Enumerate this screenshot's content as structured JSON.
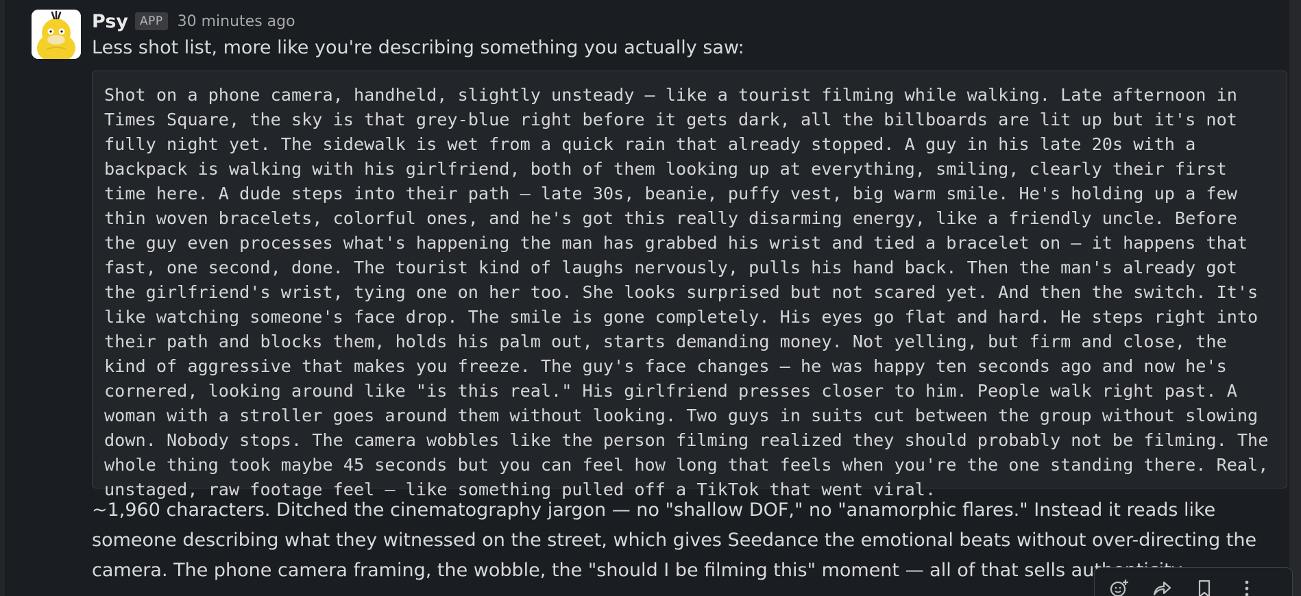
{
  "message": {
    "sender": "Psy",
    "badge": "APP",
    "timestamp": "30 minutes ago",
    "intro": "Less shot list, more like you're describing something you actually saw:",
    "code_block": "Shot on a phone camera, handheld, slightly unsteady — like a tourist filming while walking. Late afternoon in Times Square, the sky is that grey-blue right before it gets dark, all the billboards are lit up but it's not fully night yet. The sidewalk is wet from a quick rain that already stopped. A guy in his late 20s with a backpack is walking with his girlfriend, both of them looking up at everything, smiling, clearly their first time here. A dude steps into their path — late 30s, beanie, puffy vest, big warm smile. He's holding up a few thin woven bracelets, colorful ones, and he's got this really disarming energy, like a friendly uncle. Before the guy even processes what's happening the man has grabbed his wrist and tied a bracelet on — it happens that fast, one second, done. The tourist kind of laughs nervously, pulls his hand back. Then the man's already got the girlfriend's wrist, tying one on her too. She looks surprised but not scared yet. And then the switch. It's like watching someone's face drop. The smile is gone completely. His eyes go flat and hard. He steps right into their path and blocks them, holds his palm out, starts demanding money. Not yelling, but firm and close, the kind of aggressive that makes you freeze. The guy's face changes — he was happy ten seconds ago and now he's cornered, looking around like \"is this real.\" His girlfriend presses closer to him. People walk right past. A woman with a stroller goes around them without looking. Two guys in suits cut between the group without slowing down. Nobody stops. The camera wobbles like the person filming realized they should probably not be filming. The whole thing took maybe 45 seconds but you can feel how long that feels when you're the one standing there. Real, unstaged, raw footage feel — like something pulled off a TikTok that went viral.",
    "followup": "~1,960 characters. Ditched the cinematography jargon — no \"shallow DOF,\" no \"anamorphic flares.\" Instead it reads like someone describing what they witnessed on the street, which gives Seedance the emotional beats without over-directing the camera. The phone camera framing, the wobble, the \"should I be filming this\" moment — all of that sells authenticity."
  },
  "actions": [
    {
      "icon": "add-reaction-icon"
    },
    {
      "icon": "share-icon"
    },
    {
      "icon": "bookmark-icon"
    },
    {
      "icon": "more-options-icon"
    }
  ],
  "colors": {
    "background": "#1a1d21",
    "code_background": "#222529",
    "text": "#d1d2d3",
    "avatar_yellow": "#f5d02a"
  }
}
